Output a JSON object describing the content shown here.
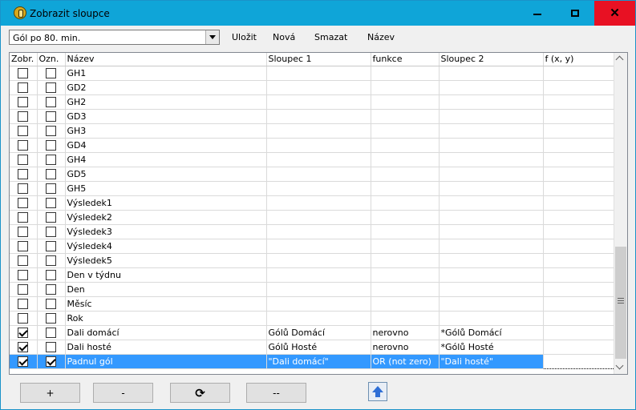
{
  "window": {
    "title": "Zobrazit sloupce",
    "minimize_glyph": "—",
    "maximize_glyph": "☐",
    "close_glyph": "✕"
  },
  "toolbar": {
    "preset_value": "Gól po 80. min.",
    "save_label": "Uložit",
    "new_label": "Nová",
    "delete_label": "Smazat",
    "name_label": "Název"
  },
  "grid": {
    "columns": [
      "Zobr.",
      "Ozn.",
      "Název",
      "Sloupec 1",
      "funkce",
      "Sloupec 2",
      "f (x, y)"
    ],
    "rows": [
      {
        "show": false,
        "mark": false,
        "name": "GH1",
        "col1": "",
        "func": "",
        "col2": "",
        "fxy": ""
      },
      {
        "show": false,
        "mark": false,
        "name": "GD2",
        "col1": "",
        "func": "",
        "col2": "",
        "fxy": ""
      },
      {
        "show": false,
        "mark": false,
        "name": "GH2",
        "col1": "",
        "func": "",
        "col2": "",
        "fxy": ""
      },
      {
        "show": false,
        "mark": false,
        "name": "GD3",
        "col1": "",
        "func": "",
        "col2": "",
        "fxy": ""
      },
      {
        "show": false,
        "mark": false,
        "name": "GH3",
        "col1": "",
        "func": "",
        "col2": "",
        "fxy": ""
      },
      {
        "show": false,
        "mark": false,
        "name": "GD4",
        "col1": "",
        "func": "",
        "col2": "",
        "fxy": ""
      },
      {
        "show": false,
        "mark": false,
        "name": "GH4",
        "col1": "",
        "func": "",
        "col2": "",
        "fxy": ""
      },
      {
        "show": false,
        "mark": false,
        "name": "GD5",
        "col1": "",
        "func": "",
        "col2": "",
        "fxy": ""
      },
      {
        "show": false,
        "mark": false,
        "name": "GH5",
        "col1": "",
        "func": "",
        "col2": "",
        "fxy": ""
      },
      {
        "show": false,
        "mark": false,
        "name": "Výsledek1",
        "col1": "",
        "func": "",
        "col2": "",
        "fxy": ""
      },
      {
        "show": false,
        "mark": false,
        "name": "Výsledek2",
        "col1": "",
        "func": "",
        "col2": "",
        "fxy": ""
      },
      {
        "show": false,
        "mark": false,
        "name": "Výsledek3",
        "col1": "",
        "func": "",
        "col2": "",
        "fxy": ""
      },
      {
        "show": false,
        "mark": false,
        "name": "Výsledek4",
        "col1": "",
        "func": "",
        "col2": "",
        "fxy": ""
      },
      {
        "show": false,
        "mark": false,
        "name": "Výsledek5",
        "col1": "",
        "func": "",
        "col2": "",
        "fxy": ""
      },
      {
        "show": false,
        "mark": false,
        "name": "Den v týdnu",
        "col1": "",
        "func": "",
        "col2": "",
        "fxy": ""
      },
      {
        "show": false,
        "mark": false,
        "name": "Den",
        "col1": "",
        "func": "",
        "col2": "",
        "fxy": ""
      },
      {
        "show": false,
        "mark": false,
        "name": "Měsíc",
        "col1": "",
        "func": "",
        "col2": "",
        "fxy": ""
      },
      {
        "show": false,
        "mark": false,
        "name": "Rok",
        "col1": "",
        "func": "",
        "col2": "",
        "fxy": ""
      },
      {
        "show": true,
        "mark": false,
        "name": "Dali domácí",
        "col1": "Gólů Domácí",
        "func": "nerovno",
        "col2": "*Gólů Domácí",
        "fxy": ""
      },
      {
        "show": true,
        "mark": false,
        "name": "Dali hosté",
        "col1": "Gólů Hosté",
        "func": "nerovno",
        "col2": "*Gólů Hosté",
        "fxy": ""
      },
      {
        "show": true,
        "mark": true,
        "name": "Padnul gól",
        "col1": "\"Dali domácí\"",
        "func": "OR (not zero)",
        "col2": "\"Dali hosté\"",
        "fxy": "",
        "selected": true
      }
    ]
  },
  "bottom": {
    "add_label": "+",
    "remove_label": "-",
    "refresh_glyph": "⟳",
    "clear_label": "--"
  }
}
